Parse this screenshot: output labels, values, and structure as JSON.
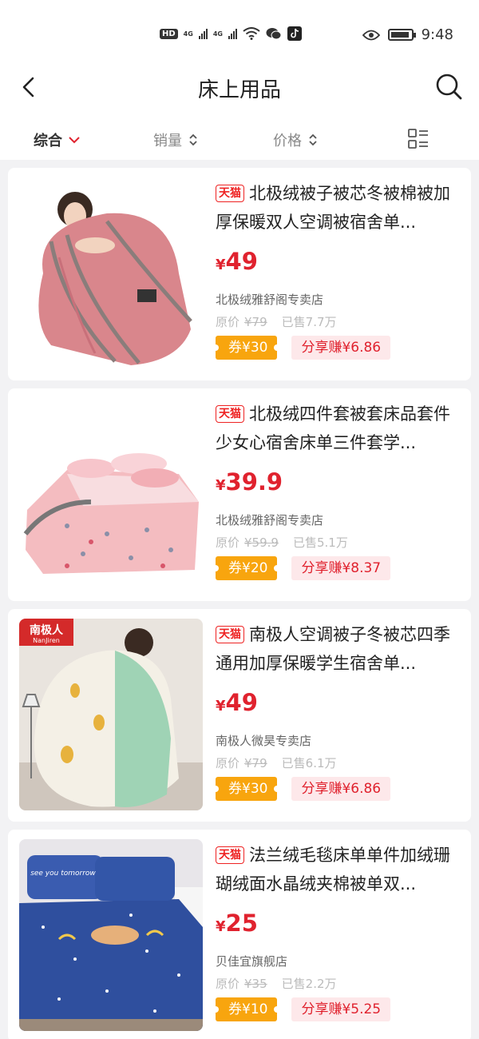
{
  "status_bar": {
    "hd_label": "HD",
    "net1": "4G",
    "net2": "4G",
    "time": "9:48",
    "icons": [
      "hd-icon",
      "signal-icon",
      "wifi-icon",
      "wechat-icon",
      "tiktok-icon",
      "eye-icon",
      "battery-icon"
    ]
  },
  "header": {
    "title": "床上用品",
    "back_icon": "back-arrow-icon",
    "search_icon": "search-icon"
  },
  "sort_bar": {
    "items": [
      {
        "label": "综合",
        "active": true,
        "icon": "chevron-down-icon"
      },
      {
        "label": "销量",
        "active": false,
        "icon": "sort-updown-icon"
      },
      {
        "label": "价格",
        "active": false,
        "icon": "sort-updown-icon"
      }
    ],
    "layout_icon": "list-layout-icon"
  },
  "products": [
    {
      "tag": "天猫",
      "title": "北极绒被子被芯冬被棉被加厚保暖双人空调被宿舍单...",
      "currency": "¥",
      "price": "49",
      "shop": "北极绒雅舒阁专卖店",
      "orig_label": "原价",
      "orig_price": "¥79",
      "sold": "已售7.7万",
      "coupon": "券¥30",
      "share": "分享赚¥6.86"
    },
    {
      "tag": "天猫",
      "title": "北极绒四件套被套床品套件少女心宿舍床单三件套学...",
      "currency": "¥",
      "price": "39.9",
      "shop": "北极绒雅舒阁专卖店",
      "orig_label": "原价",
      "orig_price": "¥59.9",
      "sold": "已售5.1万",
      "coupon": "券¥20",
      "share": "分享赚¥8.37"
    },
    {
      "tag": "天猫",
      "title": "南极人空调被子冬被芯四季通用加厚保暖学生宿舍单...",
      "currency": "¥",
      "price": "49",
      "shop": "南极人微昊专卖店",
      "orig_label": "原价",
      "orig_price": "¥79",
      "sold": "已售6.1万",
      "coupon": "券¥30",
      "share": "分享赚¥6.86",
      "image_logo": "南极人",
      "image_logo_sub": "NanJiren"
    },
    {
      "tag": "天猫",
      "title": "法兰绒毛毯床单单件加绒珊瑚绒面水晶绒夹棉被单双...",
      "currency": "¥",
      "price": "25",
      "shop": "贝佳宜旗舰店",
      "orig_label": "原价",
      "orig_price": "¥35",
      "sold": "已售2.2万",
      "coupon": "券¥10",
      "share": "分享赚¥5.25",
      "image_text": "see you tomorrow"
    }
  ]
}
